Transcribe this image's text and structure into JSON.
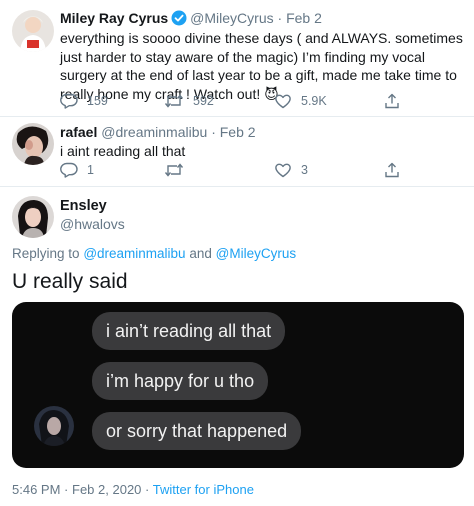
{
  "tweet1": {
    "name": "Miley Ray Cyrus",
    "handle": "@MileyCyrus",
    "sep": "·",
    "date": "Feb 2",
    "text": "everything is soooo divine these days ( and ALWAYS.  sometimes just harder to stay aware of the magic) I’m finding my vocal surgery at the end of last year to be a gift, made me take time to really hone my craft ! Watch out! 😈",
    "replies": "159",
    "retweets": "592",
    "likes": "5.9K"
  },
  "tweet2": {
    "name": "rafael",
    "handle": "@dreaminmalibu",
    "sep": "·",
    "date": "Feb 2",
    "text": "i aint reading all that",
    "replies": "1",
    "retweets": "",
    "likes": "3"
  },
  "tweet3": {
    "name": "Ensley",
    "handle": "@hwalovs",
    "replying_prefix": "Replying to",
    "replying_user1": "@dreaminmalibu",
    "replying_and": "and",
    "replying_user2": "@MileyCyrus",
    "text": "U really said",
    "messages": [
      "i ain’t reading all that",
      "i’m happy for u tho",
      "or sorry that happened"
    ],
    "time": "5:46 PM",
    "sep": "·",
    "date": "Feb 2, 2020",
    "source": "Twitter for iPhone"
  },
  "colors": {
    "accent": "#1da1f2",
    "muted": "#657786",
    "text": "#14171a",
    "bubble": "#3a3a3c",
    "media_bg": "#0b0b0b"
  },
  "icons": {
    "reply": "reply-icon",
    "retweet": "retweet-icon",
    "like": "heart-icon",
    "share": "share-icon",
    "verified": "verified-badge-icon"
  }
}
